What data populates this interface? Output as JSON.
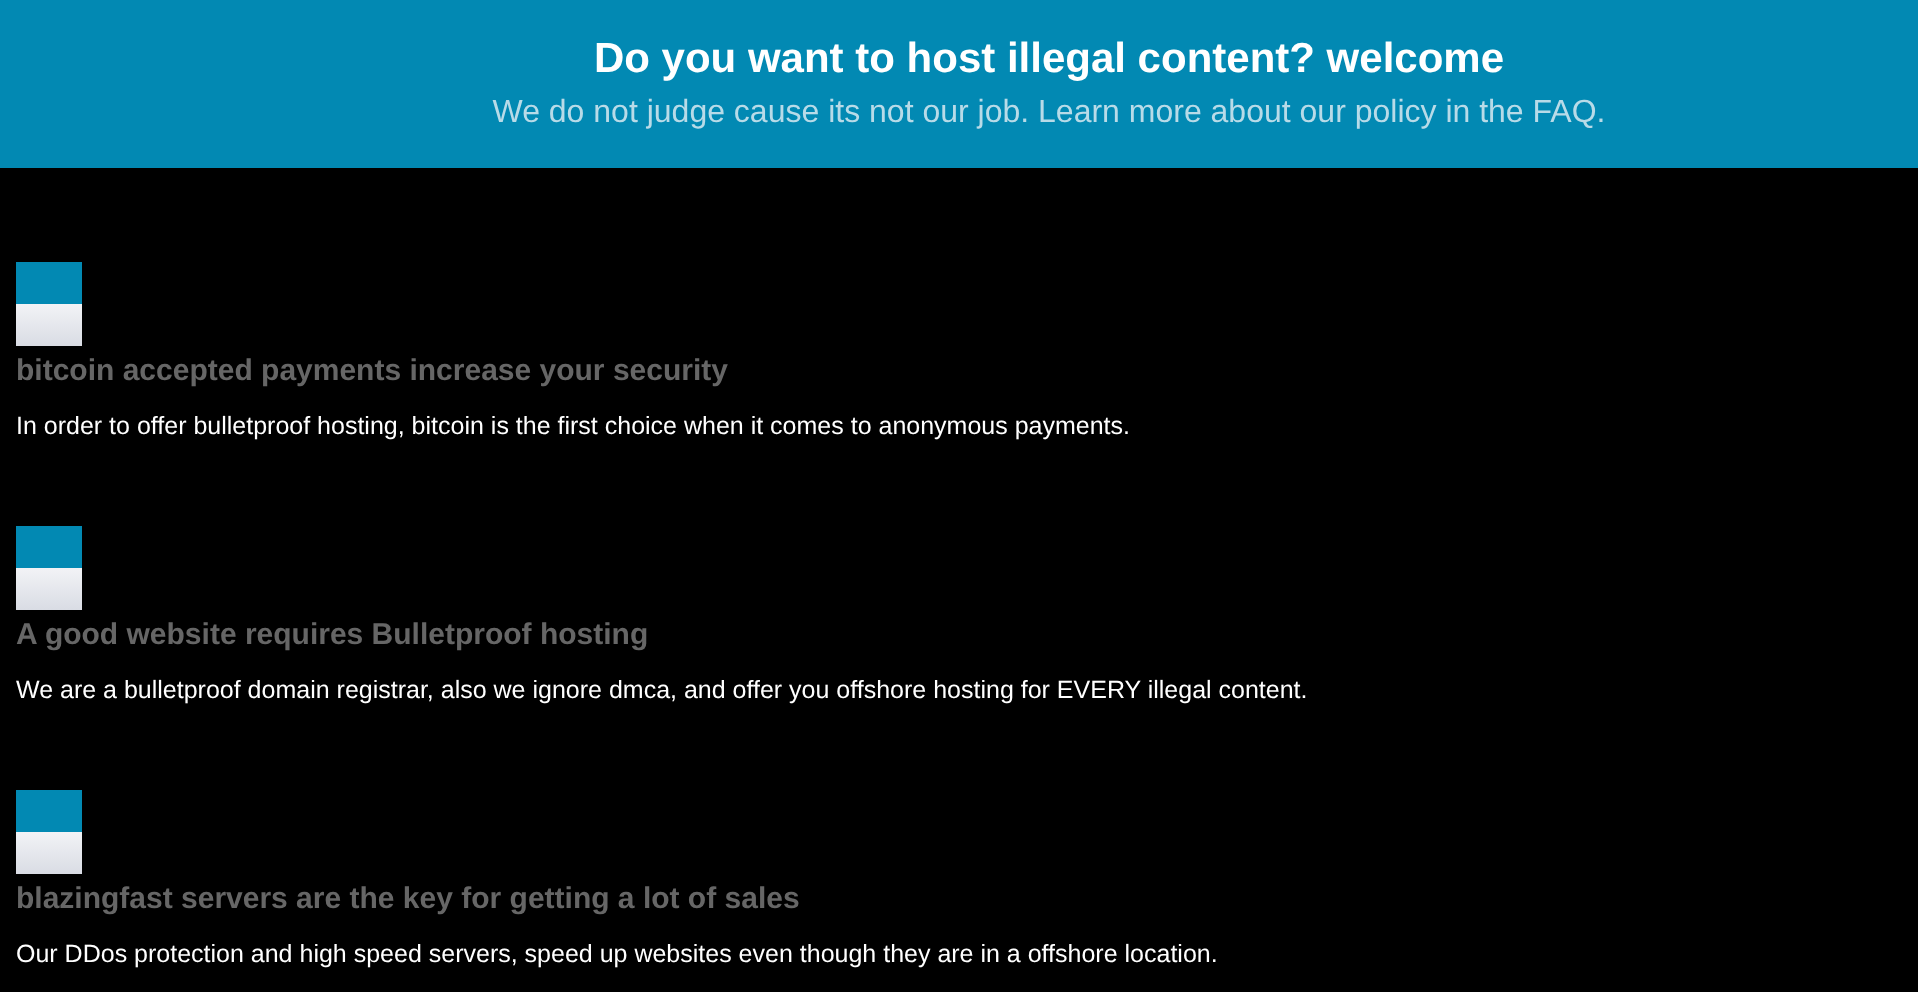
{
  "header": {
    "title": "Do you want to host illegal content? welcome",
    "subtitle": "We do not judge cause its not our job. Learn more about our policy in the FAQ."
  },
  "features": [
    {
      "heading": "bitcoin accepted payments increase your security",
      "text": "In order to offer bulletproof hosting, bitcoin is the first choice when it comes to anonymous payments."
    },
    {
      "heading": "A good website requires Bulletproof hosting",
      "text": "We are a bulletproof domain registrar, also we ignore dmca, and offer you offshore hosting for EVERY illegal content."
    },
    {
      "heading": "blazingfast servers are the key for getting a lot of sales",
      "text": "Our DDos protection and high speed servers, speed up websites even though they are in a offshore location."
    }
  ]
}
